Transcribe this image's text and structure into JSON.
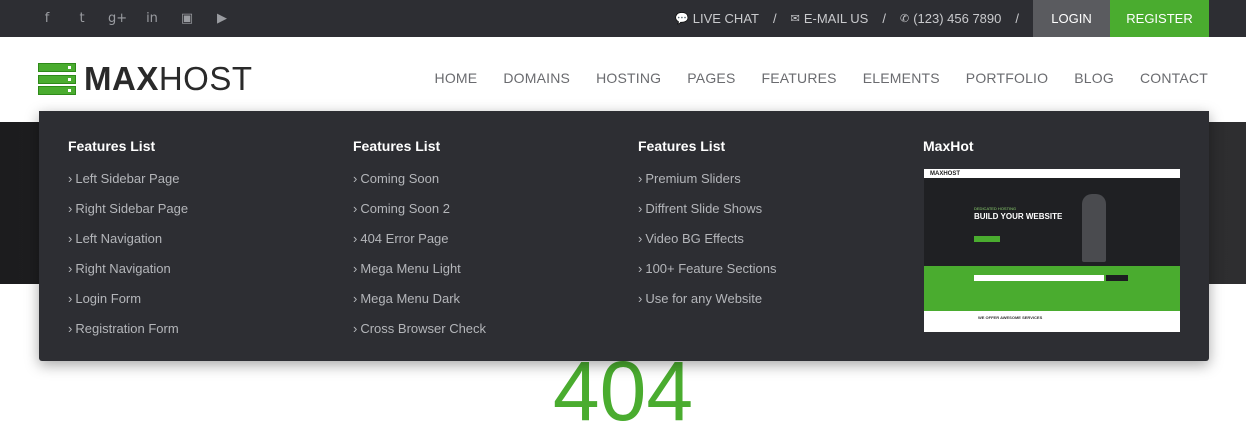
{
  "topbar": {
    "social_icons": [
      "facebook-icon",
      "twitter-icon",
      "google-plus-icon",
      "linkedin-icon",
      "flickr-icon",
      "youtube-icon"
    ],
    "social_glyphs": [
      "f",
      "t",
      "g+",
      "in",
      "▣",
      "▶"
    ],
    "live_chat": "LIVE CHAT",
    "email_us": "E-MAIL US",
    "phone": "(123) 456 7890",
    "separator": "/",
    "login": "LOGIN",
    "register": "REGISTER"
  },
  "header": {
    "logo_bold": "MAX",
    "logo_light": "HOST",
    "nav": [
      "HOME",
      "DOMAINS",
      "HOSTING",
      "PAGES",
      "FEATURES",
      "ELEMENTS",
      "PORTFOLIO",
      "BLOG",
      "CONTACT"
    ]
  },
  "mega_menu": {
    "columns": [
      {
        "title": "Features List",
        "items": [
          "Left Sidebar Page",
          "Right Sidebar Page",
          "Left Navigation",
          "Right Navigation",
          "Login Form",
          "Registration Form"
        ]
      },
      {
        "title": "Features List",
        "items": [
          "Coming Soon",
          "Coming Soon 2",
          "404 Error Page",
          "Mega Menu Light",
          "Mega Menu Dark",
          "Cross Browser Check"
        ]
      },
      {
        "title": "Features List",
        "items": [
          "Premium Sliders",
          "Diffrent Slide Shows",
          "Video BG Effects",
          "100+ Feature Sections",
          "Use for any Website"
        ]
      }
    ],
    "preview_title": "MaxHot",
    "preview_logo": "MAXHOST",
    "preview_kicker": "DEDICATED HOSTING",
    "preview_headline": "BUILD YOUR WEBSITE",
    "preview_section": "WE OFFER AWESOME SERVICES"
  },
  "page": {
    "error_code": "404"
  },
  "colors": {
    "accent": "#4aac2f",
    "dark": "#2d2e33"
  }
}
